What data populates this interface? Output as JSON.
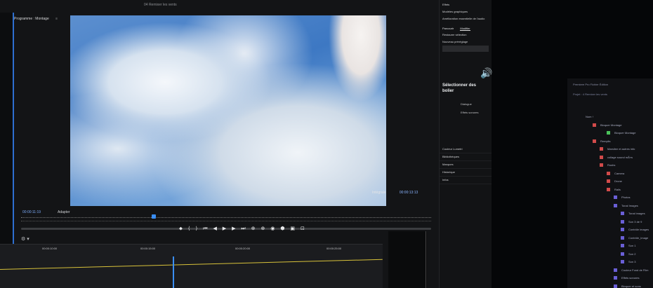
{
  "window": {
    "title": "04 Remixer les vents"
  },
  "program_monitor": {
    "tab_label": "Programme : Montage",
    "tab_close": "≡",
    "fit": "Intégrale",
    "timecode_right": "00:00:13:13",
    "timecode_left": "00:00:11:19",
    "fit_select": "Adapter",
    "settings_icon": "gear-icon"
  },
  "transport": {
    "buttons": "⬥ ⟨ ⟩ ⏮ ◀ ▶ ▶ ⏭ ⊕ ⊕ ◉ ⬢ ▣ ⊡"
  },
  "timeline": {
    "times": [
      "00:00:10:00",
      "00:00:15:00",
      "00:00:20:00",
      "00:00:25:00"
    ],
    "track_color": "#d8c23a",
    "playhead_color": "#3a8ef5"
  },
  "right_panel": {
    "header_lines": [
      "Effets",
      "Modèles graphiques",
      "Amélioration essentielle de l'audio"
    ],
    "tabs": [
      "Parcourir",
      "Modifier"
    ],
    "active_tab": "Modifier",
    "preset_lines": [
      "Restaurer sélection",
      "Nouveau préréglage"
    ],
    "speaker_icon": "speaker-icon",
    "bold_text": [
      "Sélectionner des",
      "bolier"
    ],
    "options": [
      "Dialogue",
      "Effets sonores"
    ],
    "sections": [
      "Couleur Lumetri",
      "Bibliothèques",
      "Marques",
      "Historique",
      "Infos"
    ]
  },
  "second_monitor": {
    "title": "Premiere Pro  Fichier  Édition",
    "tab": "Projet : 4 Remixer les vents",
    "rows": [
      {
        "label": "Nom ↑",
        "color": ""
      },
      {
        "label": "Bloquer Montage",
        "color": "#d14a4a"
      },
      {
        "label": "Bloquer Montage",
        "color": "#4ac25a"
      },
      {
        "label": "Remplis",
        "color": "#d14a4a"
      },
      {
        "label": "Marsilee et autres info",
        "color": "#d14a4a"
      },
      {
        "label": "collage sound mÃ»s",
        "color": "#d14a4a"
      },
      {
        "label": "Rushs",
        "color": "#d14a4a"
      },
      {
        "label": "Camera",
        "color": "#d14a4a"
      },
      {
        "label": "Drone",
        "color": "#d14a4a"
      },
      {
        "label": "Rails",
        "color": "#d14a4a"
      },
      {
        "label": "Photos",
        "color": "#6a5fd6"
      },
      {
        "label": "Tonal Images",
        "color": "#6a5fd6"
      },
      {
        "label": "Tonal images",
        "color": "#6a5fd6"
      },
      {
        "label": "Son 3 de 9",
        "color": "#6a5fd6"
      },
      {
        "label": "Contrôle images",
        "color": "#6a5fd6"
      },
      {
        "label": "Contrôle_image",
        "color": "#6a5fd6"
      },
      {
        "label": "Son 1",
        "color": "#6a5fd6"
      },
      {
        "label": "Son 2",
        "color": "#6a5fd6"
      },
      {
        "label": "Son 3",
        "color": "#6a5fd6"
      },
      {
        "label": "Couleur Fond de Film",
        "color": "#6a5fd6"
      },
      {
        "label": "Effets sonores",
        "color": "#6a5fd6"
      },
      {
        "label": "Bloquer et sons",
        "color": "#6a5fd6"
      }
    ]
  }
}
